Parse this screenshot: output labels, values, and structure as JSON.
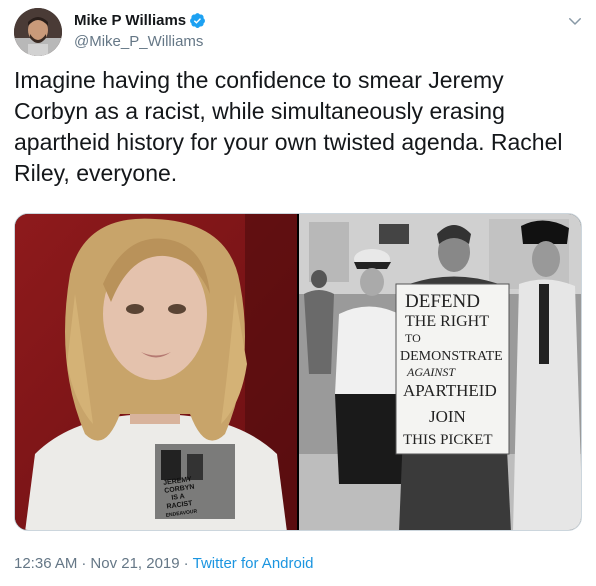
{
  "author": {
    "display_name": "Mike P Williams",
    "handle": "@Mike_P_Williams",
    "verified": true
  },
  "tweet": {
    "text": "Imagine having the confidence to smear Jeremy Corbyn as a racist, while simultaneously erasing apartheid history for your own twisted agenda. Rachel Riley, everyone."
  },
  "media": {
    "left_shirt_text": [
      "JEREMY",
      "CORBYN",
      "IS A",
      "RACIST",
      "ENDEAVOUR"
    ],
    "right_sign_text": [
      "DEFEND",
      "THE RIGHT",
      "TO",
      "DEMONSTRATE",
      "AGAINST",
      "APARTHEID",
      "JOIN",
      "THIS PICKET"
    ]
  },
  "footer": {
    "time": "12:36 AM",
    "separator": "·",
    "date": "Nov 21, 2019",
    "source": "Twitter for Android"
  },
  "colors": {
    "text": "#14171a",
    "secondary": "#657786",
    "link": "#1b95e0",
    "verified": "#1da1f2"
  },
  "icons": [
    "verified-badge-icon",
    "chevron-down-icon"
  ]
}
